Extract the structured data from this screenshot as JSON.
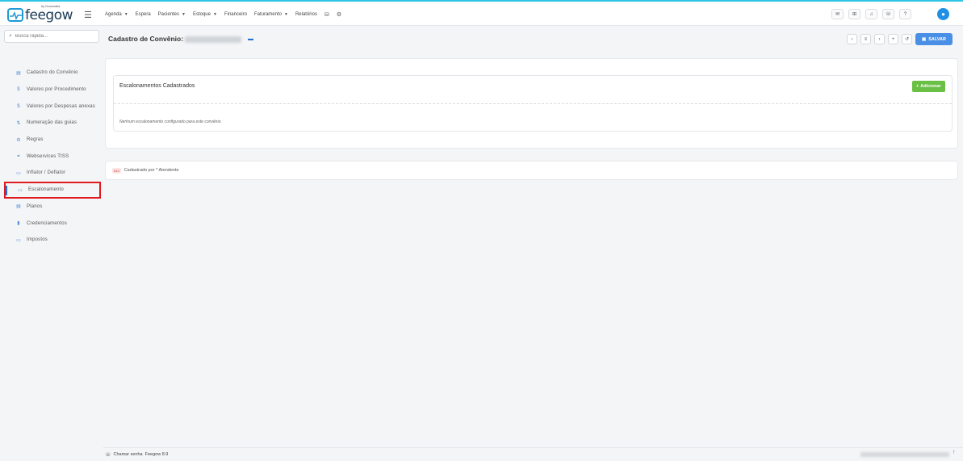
{
  "brand": {
    "name": "feegow",
    "byline": "by Doctoralia"
  },
  "nav": {
    "items": [
      {
        "label": "Agenda",
        "dropdown": true
      },
      {
        "label": "Espera",
        "dropdown": false
      },
      {
        "label": "Pacientes",
        "dropdown": true
      },
      {
        "label": "Estoque",
        "dropdown": true
      },
      {
        "label": "Financeiro",
        "dropdown": false
      },
      {
        "label": "Faturamento",
        "dropdown": true
      },
      {
        "label": "Relatórios",
        "dropdown": false
      }
    ]
  },
  "search": {
    "placeholder": "Busca rápida..."
  },
  "sidebar": {
    "items": [
      {
        "label": "Cadastro do Convênio",
        "icon": "table-icon"
      },
      {
        "label": "Valores por Procedimento",
        "icon": "dollar-icon"
      },
      {
        "label": "Valores por Despesas anexas",
        "icon": "dollar-icon"
      },
      {
        "label": "Numeração das guias",
        "icon": "sort-icon"
      },
      {
        "label": "Regras",
        "icon": "cogs-icon"
      },
      {
        "label": "Webservices TISS",
        "icon": "plug-icon"
      },
      {
        "label": "Inflator / Deflator",
        "icon": "card-icon"
      },
      {
        "label": "Escalonamento",
        "icon": "card-icon",
        "active": true
      },
      {
        "label": "Planos",
        "icon": "table-icon"
      },
      {
        "label": "Credenciamentos",
        "icon": "book-icon"
      },
      {
        "label": "Impostos",
        "icon": "card-icon"
      }
    ]
  },
  "header": {
    "title": "Cadastro de Convênio:",
    "save_label": "SALVAR"
  },
  "section": {
    "title": "Escalonamentos Cadastrados",
    "add_label": "Adicionar",
    "empty_message": "Nenhum escalonamento configurado para este convênio."
  },
  "audit": {
    "tag": "#14",
    "text": "Cadastrado por * Atendente"
  },
  "statusbar": {
    "call_label": "Chamar senha",
    "version": "Feegow 8.9"
  },
  "colors": {
    "accent": "#2ec4e6",
    "primary": "#4a8fe6",
    "success": "#6abf45",
    "highlight": "#e0191e"
  }
}
